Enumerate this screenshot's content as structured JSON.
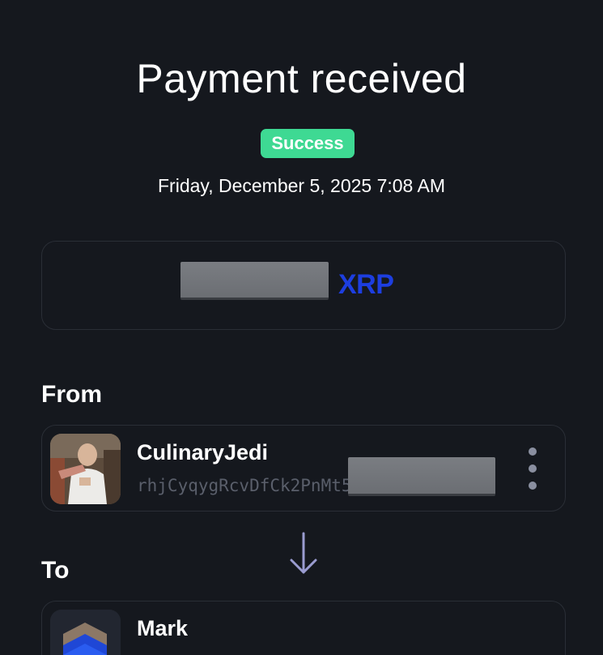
{
  "header": {
    "title": "Payment received",
    "status_badge": "Success",
    "datetime": "Friday, December 5, 2025 7:08 AM"
  },
  "amount": {
    "currency": "XRP"
  },
  "from": {
    "label": "From",
    "name": "CulinaryJedi",
    "address": "rhjCyqygRcvDfCk2PnMt5"
  },
  "to": {
    "label": "To",
    "name": "Mark"
  },
  "colors": {
    "background": "#15181e",
    "success": "#3ed993",
    "xrp_blue": "#1d3ee0",
    "card_border": "#2a2e36",
    "muted_text": "#5a5f6b"
  },
  "icons": {
    "menu": "more-vertical-icon",
    "arrow": "arrow-down-icon"
  }
}
